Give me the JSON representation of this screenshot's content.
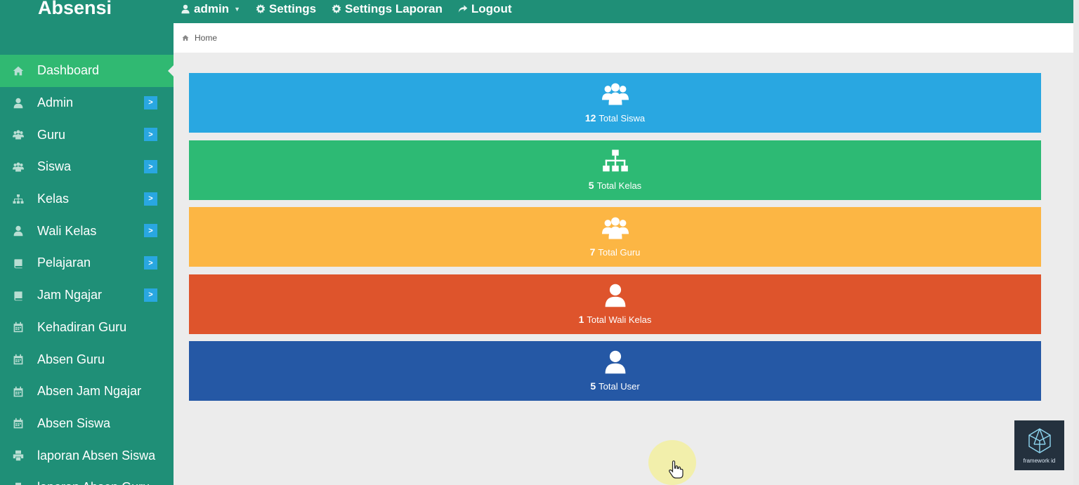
{
  "brand": "Absensi",
  "topnav": [
    {
      "label": "admin",
      "icon": "user-icon",
      "dropdown": true
    },
    {
      "label": "Settings",
      "icon": "gear-icon"
    },
    {
      "label": "Settings Laporan",
      "icon": "gear-icon"
    },
    {
      "label": "Logout",
      "icon": "share-icon"
    }
  ],
  "breadcrumb": {
    "label": "Home",
    "icon": "home-icon"
  },
  "sidebar": {
    "items": [
      {
        "label": "Dashboard",
        "icon": "home-icon",
        "active": true,
        "expandable": false
      },
      {
        "label": "Admin",
        "icon": "user-icon",
        "expandable": true
      },
      {
        "label": "Guru",
        "icon": "users-icon",
        "expandable": true
      },
      {
        "label": "Siswa",
        "icon": "users-icon",
        "expandable": true
      },
      {
        "label": "Kelas",
        "icon": "sitemap-icon",
        "expandable": true
      },
      {
        "label": "Wali Kelas",
        "icon": "user-icon",
        "expandable": true
      },
      {
        "label": "Pelajaran",
        "icon": "book-icon",
        "expandable": true
      },
      {
        "label": "Jam Ngajar",
        "icon": "book-icon",
        "expandable": true
      },
      {
        "label": "Kehadiran Guru",
        "icon": "calendar-icon",
        "expandable": false
      },
      {
        "label": "Absen Guru",
        "icon": "calendar-icon",
        "expandable": false
      },
      {
        "label": "Absen Jam Ngajar",
        "icon": "calendar-icon",
        "expandable": false
      },
      {
        "label": "Absen Siswa",
        "icon": "calendar-icon",
        "expandable": false
      },
      {
        "label": "laporan Absen Siswa",
        "icon": "print-icon",
        "expandable": false
      },
      {
        "label": "laporan Absen Guru",
        "icon": "print-icon",
        "expandable": false
      }
    ],
    "expand_label": ">"
  },
  "stats": [
    {
      "count": "12",
      "label": "Total Siswa",
      "icon": "users-icon",
      "color": "#29a7e1"
    },
    {
      "count": "5",
      "label": "Total Kelas",
      "icon": "sitemap-icon",
      "color": "#2dba74"
    },
    {
      "count": "7",
      "label": "Total Guru",
      "icon": "users-icon",
      "color": "#fcb644"
    },
    {
      "count": "1",
      "label": "Total Wali Kelas",
      "icon": "user-icon",
      "color": "#de542c"
    },
    {
      "count": "5",
      "label": "Total User",
      "icon": "user-icon",
      "color": "#2558a5"
    }
  ],
  "watermark": {
    "label": "framework id"
  },
  "colors": {
    "header": "#1f8f77",
    "sidebar": "#1f8f77",
    "active": "#30b972",
    "expand": "#29a7e1",
    "background": "#ececec"
  }
}
